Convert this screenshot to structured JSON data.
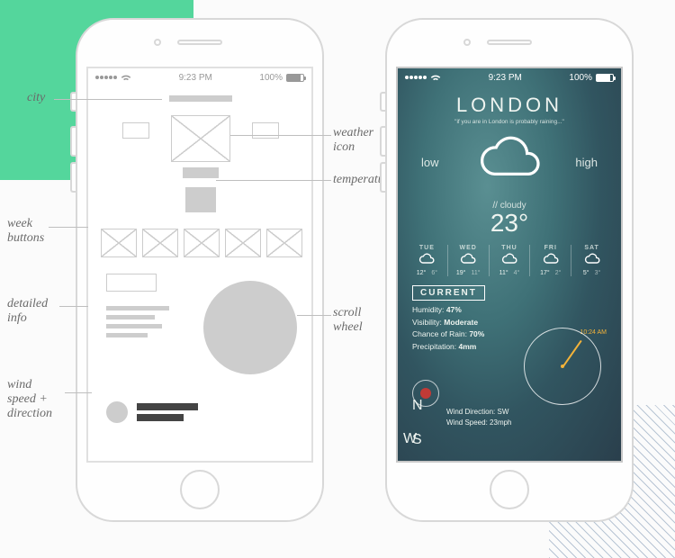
{
  "decor": {
    "mint": "#54d69c"
  },
  "statusbar": {
    "time": "9:23 PM",
    "battery": "100%"
  },
  "annotations": {
    "city": "city",
    "weather_icon": "weather\nicon",
    "temperature": "temperature",
    "week_buttons": "week\nbuttons",
    "detailed_info": "detailed\ninfo",
    "scroll_wheel": "scroll\nwheel",
    "wind": "wind\nspeed +\ndirection"
  },
  "weather": {
    "city": "LONDON",
    "quote": "\"if you are in London is probably raining...\"",
    "low_label": "low",
    "high_label": "high",
    "condition": "// cloudy",
    "temperature": "23°",
    "forecast": [
      {
        "day": "TUE",
        "hi": "12°",
        "lo": "6°"
      },
      {
        "day": "WED",
        "hi": "19°",
        "lo": "11°"
      },
      {
        "day": "THU",
        "hi": "11°",
        "lo": "4°"
      },
      {
        "day": "FRI",
        "hi": "17°",
        "lo": "2°"
      },
      {
        "day": "SAT",
        "hi": "5°",
        "lo": "3°"
      }
    ],
    "current_label": "CURRENT",
    "scroll_time": "10:24 AM",
    "details": {
      "humidity_label": "Humidity:",
      "humidity": "47%",
      "visibility_label": "Visibility:",
      "visibility": "Moderate",
      "rain_label": "Chance of Rain:",
      "rain": "70%",
      "precipitation_label": "Precipitation:",
      "precipitation": "4mm"
    },
    "compass": {
      "n": "N",
      "s": "S",
      "w": "W"
    },
    "wind": {
      "dir_label": "Wind Direction:",
      "dir": "SW",
      "speed_label": "Wind Speed:",
      "speed": "23mph"
    }
  }
}
